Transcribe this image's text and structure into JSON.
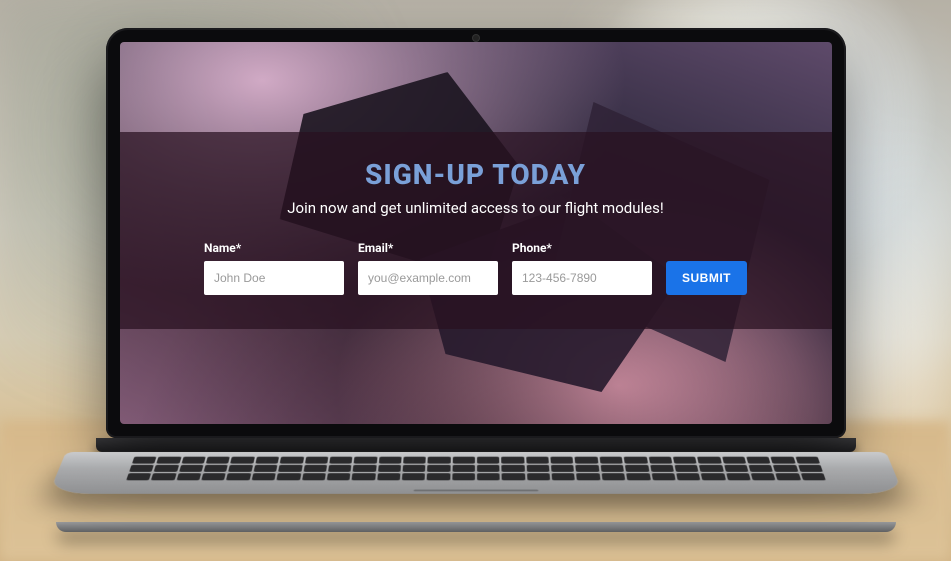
{
  "form": {
    "title": "SIGN-UP TODAY",
    "subtitle": "Join now and get unlimited access to our flight modules!",
    "name": {
      "label": "Name*",
      "placeholder": "John Doe"
    },
    "email": {
      "label": "Email*",
      "placeholder": "you@example.com"
    },
    "phone": {
      "label": "Phone*",
      "placeholder": "123-456-7890"
    },
    "submit_label": "SUBMIT"
  }
}
